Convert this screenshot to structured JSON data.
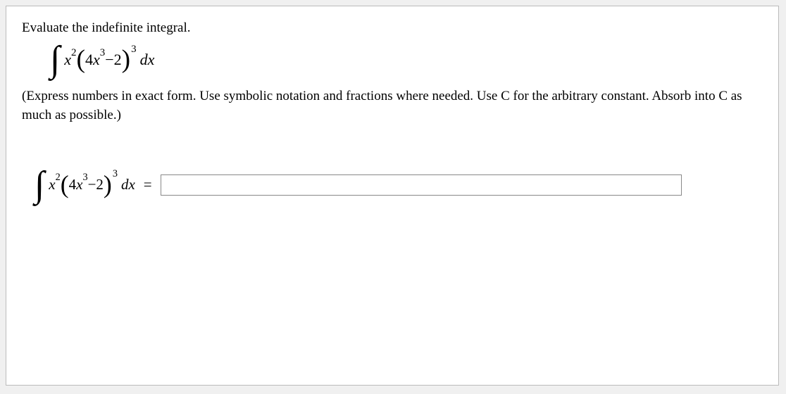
{
  "prompt": "Evaluate the indefinite integral.",
  "instructions": "(Express numbers in exact form. Use symbolic notation and fractions where needed. Use C for the arbitrary constant. Absorb into C as much as possible.)",
  "integral": {
    "outer_x": "x",
    "outer_x_exp": "2",
    "lparen": "(",
    "inner_coef": "4",
    "inner_x": "x",
    "inner_x_exp": "3",
    "minus": " − ",
    "inner_const": "2",
    "rparen": ")",
    "outer_exp": "3",
    "dx": "dx"
  },
  "equals": "=",
  "answer_value": ""
}
